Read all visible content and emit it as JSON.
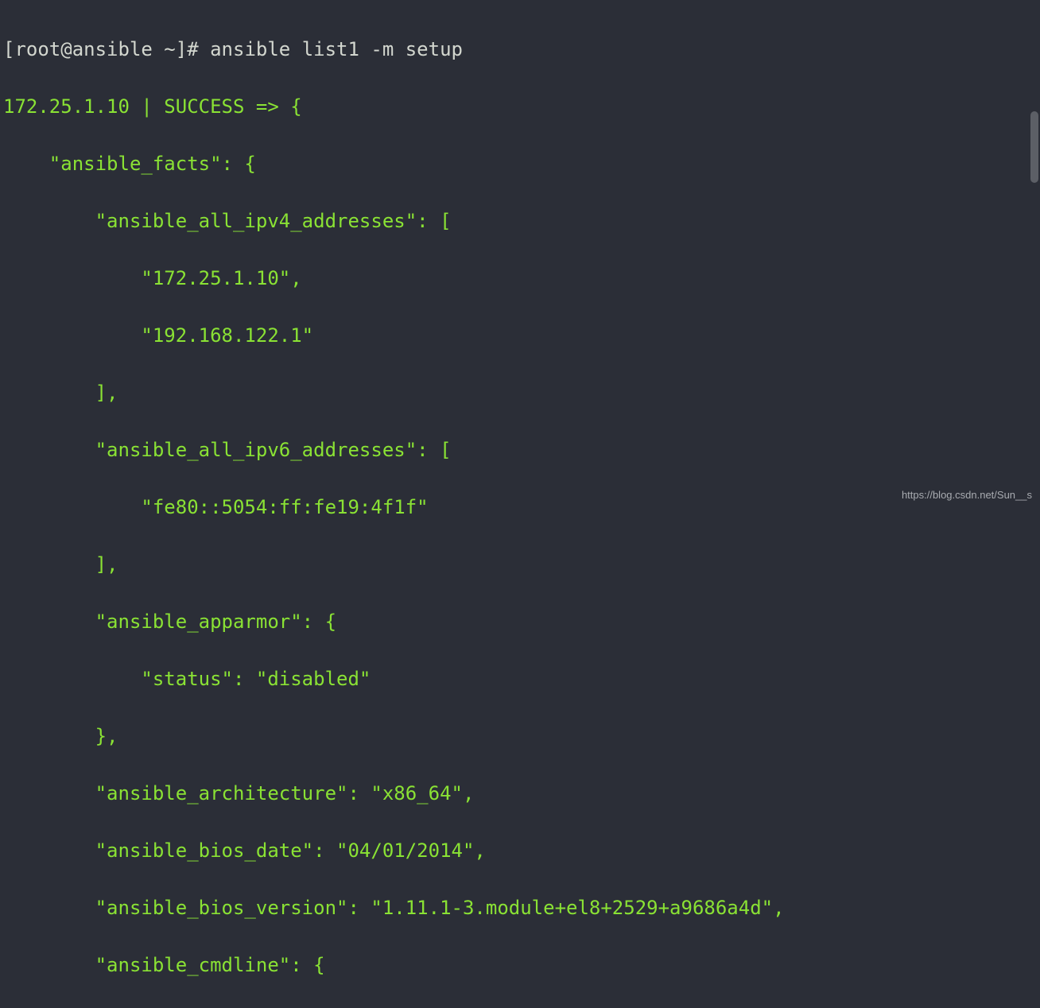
{
  "prompt": {
    "full": "[root@ansible ~]# ",
    "command": "ansible list1 -m setup"
  },
  "output": {
    "header": "172.25.1.10 | SUCCESS => {",
    "lines": [
      "    \"ansible_facts\": {",
      "        \"ansible_all_ipv4_addresses\": [",
      "            \"172.25.1.10\",",
      "            \"192.168.122.1\"",
      "        ],",
      "        \"ansible_all_ipv6_addresses\": [",
      "            \"fe80::5054:ff:fe19:4f1f\"",
      "        ],",
      "        \"ansible_apparmor\": {",
      "            \"status\": \"disabled\"",
      "        },",
      "        \"ansible_architecture\": \"x86_64\",",
      "        \"ansible_bios_date\": \"04/01/2014\",",
      "        \"ansible_bios_version\": \"1.11.1-3.module+el8+2529+a9686a4d\",",
      "        \"ansible_cmdline\": {"
    ]
  },
  "watermark": "https://blog.csdn.net/Sun__s"
}
